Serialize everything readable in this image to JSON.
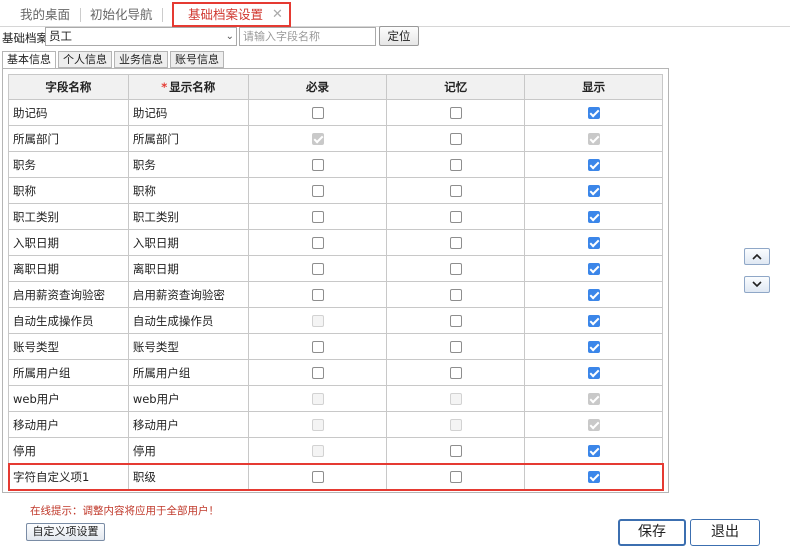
{
  "tabs": [
    {
      "label": "我的桌面"
    },
    {
      "label": "初始化导航"
    },
    {
      "label": "基础档案设置",
      "active": true
    }
  ],
  "archive": {
    "label": "基础档案",
    "selected": "员工",
    "search_placeholder": "请输入字段名称",
    "locate_button": "定位"
  },
  "subtabs": [
    "基本信息",
    "个人信息",
    "业务信息",
    "账号信息"
  ],
  "table": {
    "headers": {
      "field_name": "字段名称",
      "display_name": "显示名称",
      "required": "必录",
      "memory": "记忆",
      "display": "显示"
    },
    "rows": [
      {
        "field": "助记码",
        "display_name": "助记码",
        "required": false,
        "required_disabled": false,
        "memory": false,
        "memory_disabled": false,
        "display": true,
        "display_disabled": false
      },
      {
        "field": "所属部门",
        "display_name": "所属部门",
        "required": true,
        "required_disabled": true,
        "memory": false,
        "memory_disabled": false,
        "display": true,
        "display_disabled": true
      },
      {
        "field": "职务",
        "display_name": "职务",
        "required": false,
        "required_disabled": false,
        "memory": false,
        "memory_disabled": false,
        "display": true,
        "display_disabled": false
      },
      {
        "field": "职称",
        "display_name": "职称",
        "required": false,
        "required_disabled": false,
        "memory": false,
        "memory_disabled": false,
        "display": true,
        "display_disabled": false
      },
      {
        "field": "职工类别",
        "display_name": "职工类别",
        "required": false,
        "required_disabled": false,
        "memory": false,
        "memory_disabled": false,
        "display": true,
        "display_disabled": false
      },
      {
        "field": "入职日期",
        "display_name": "入职日期",
        "required": false,
        "required_disabled": false,
        "memory": false,
        "memory_disabled": false,
        "display": true,
        "display_disabled": false
      },
      {
        "field": "离职日期",
        "display_name": "离职日期",
        "required": false,
        "required_disabled": false,
        "memory": false,
        "memory_disabled": false,
        "display": true,
        "display_disabled": false
      },
      {
        "field": "启用薪资查询验密",
        "display_name": "启用薪资查询验密",
        "required": false,
        "required_disabled": false,
        "memory": false,
        "memory_disabled": false,
        "display": true,
        "display_disabled": false
      },
      {
        "field": "自动生成操作员",
        "display_name": "自动生成操作员",
        "required": false,
        "required_disabled": true,
        "memory": false,
        "memory_disabled": false,
        "display": true,
        "display_disabled": false
      },
      {
        "field": "账号类型",
        "display_name": "账号类型",
        "required": false,
        "required_disabled": false,
        "memory": false,
        "memory_disabled": false,
        "display": true,
        "display_disabled": false
      },
      {
        "field": "所属用户组",
        "display_name": "所属用户组",
        "required": false,
        "required_disabled": false,
        "memory": false,
        "memory_disabled": false,
        "display": true,
        "display_disabled": false
      },
      {
        "field": "web用户",
        "display_name": "web用户",
        "required": false,
        "required_disabled": true,
        "memory": false,
        "memory_disabled": true,
        "display": true,
        "display_disabled": true
      },
      {
        "field": "移动用户",
        "display_name": "移动用户",
        "required": false,
        "required_disabled": true,
        "memory": false,
        "memory_disabled": true,
        "display": true,
        "display_disabled": true
      },
      {
        "field": "停用",
        "display_name": "停用",
        "required": false,
        "required_disabled": true,
        "memory": false,
        "memory_disabled": false,
        "display": true,
        "display_disabled": false
      },
      {
        "field": "字符自定义项1",
        "display_name": "职级",
        "required": false,
        "required_disabled": false,
        "memory": false,
        "memory_disabled": false,
        "display": true,
        "display_disabled": false
      }
    ]
  },
  "hint": "在线提示：调整内容将应用于全部用户！",
  "buttons": {
    "custom": "自定义项设置",
    "save": "保存",
    "exit": "退出"
  },
  "colors": {
    "highlight": "#e53a32",
    "checkbox_checked": "#3b86e9"
  }
}
